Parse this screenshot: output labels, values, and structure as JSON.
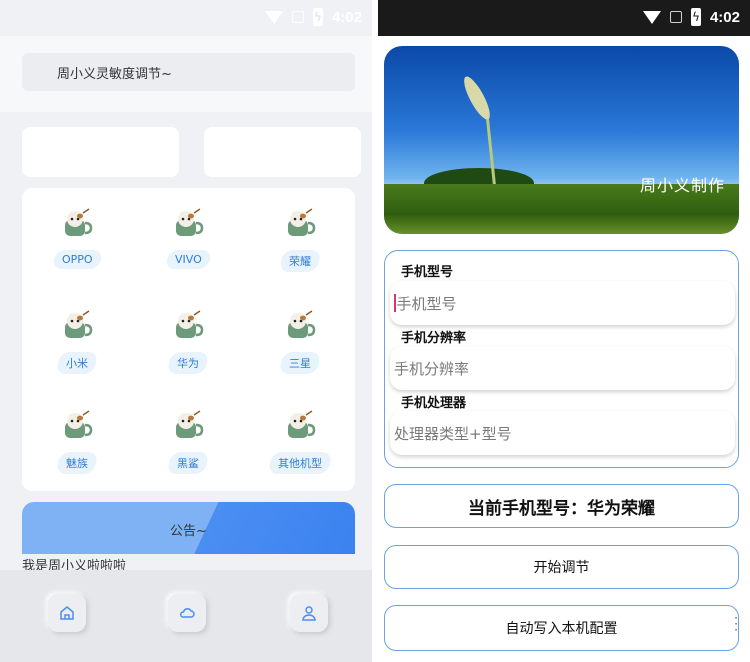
{
  "left": {
    "status": {
      "time": "4:02"
    },
    "search": {
      "label": "周小义灵敏度调节~"
    },
    "brands": [
      "OPPO",
      "VIVO",
      "荣耀",
      "小米",
      "华为",
      "三星",
      "魅族",
      "黑鲨",
      "其他机型"
    ],
    "notice": {
      "title": "公告~",
      "text": "我是周小义啦啦啦"
    },
    "nav": [
      "home-icon",
      "cloud-icon",
      "user-icon"
    ]
  },
  "right": {
    "status": {
      "time": "4:02"
    },
    "hero": {
      "watermark": "周小义制作"
    },
    "form": {
      "model_label": "手机型号",
      "model_placeholder": "手机型号",
      "resolution_label": "手机分辨率",
      "resolution_placeholder": "手机分辨率",
      "processor_label": "手机处理器",
      "processor_placeholder": "处理器类型+型号"
    },
    "current": "当前手机型号：华为荣耀",
    "start_button": "开始调节",
    "auto_button": "自动写入本机配置"
  },
  "colors": {
    "accent_border": "#6aa3e0",
    "pill_text": "#2d7fd6",
    "notice_light": "#7fb2f5",
    "notice_dark": "#3b82f0"
  }
}
